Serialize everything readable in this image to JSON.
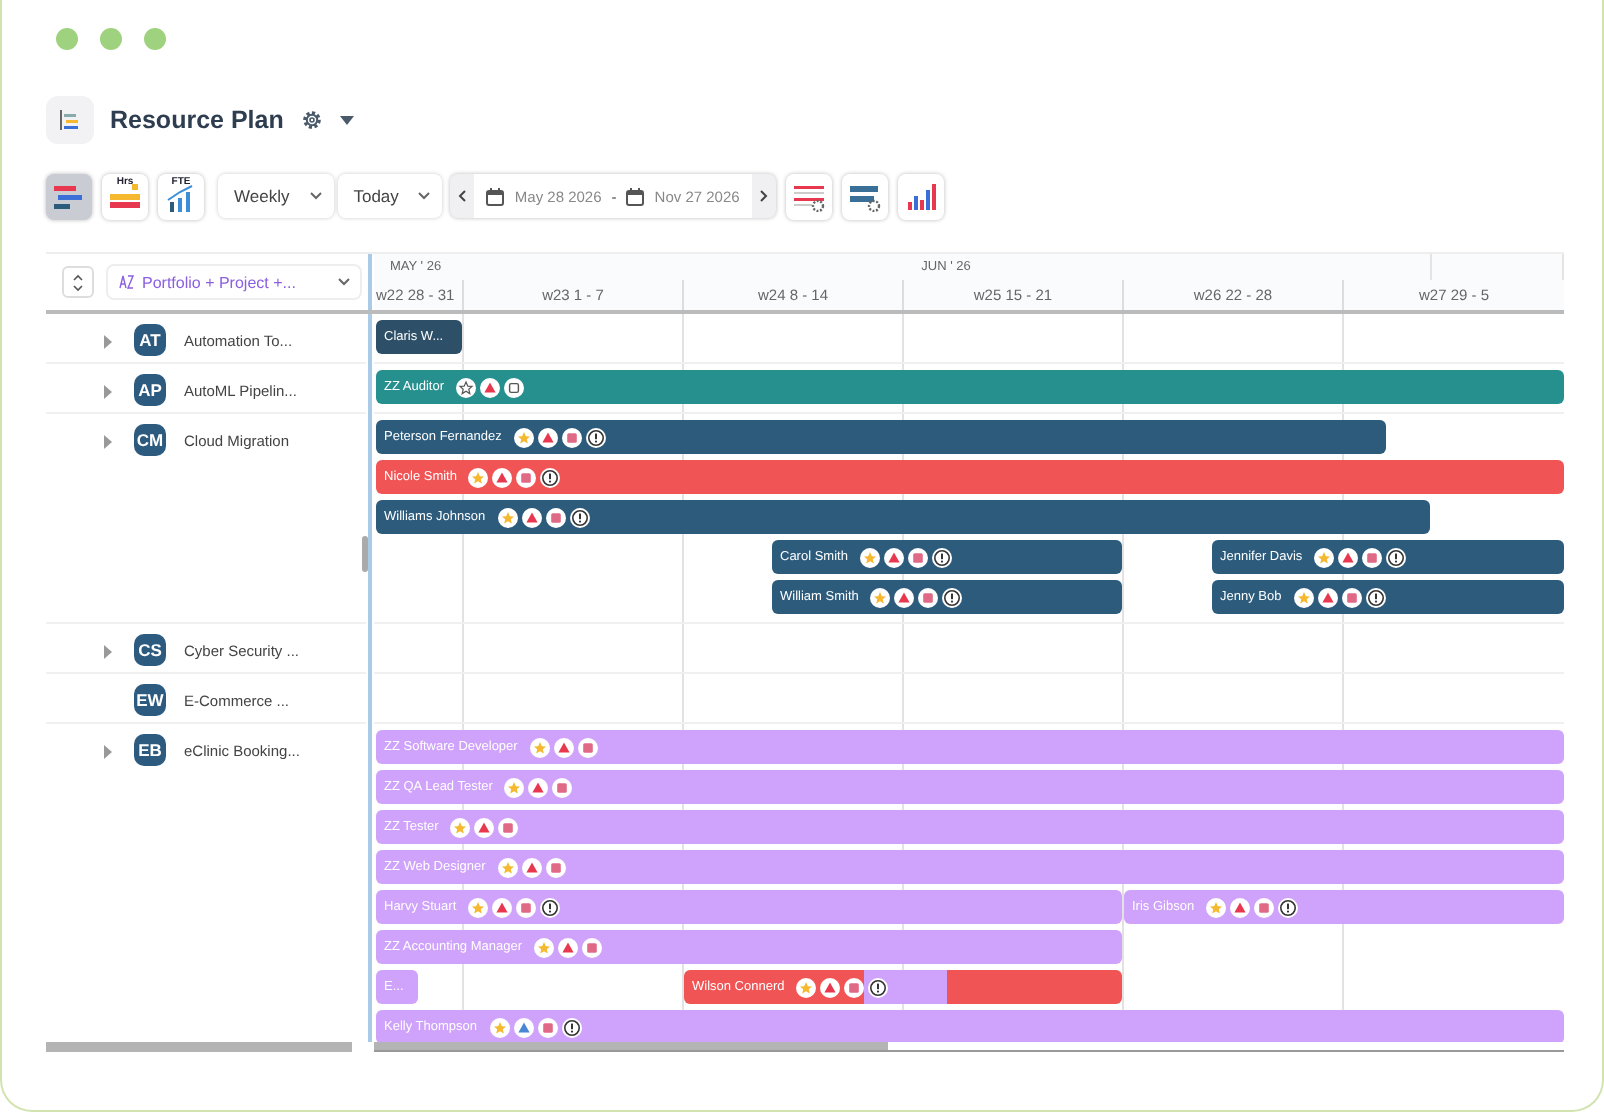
{
  "header": {
    "title": "Resource Plan"
  },
  "toolbar": {
    "views": [
      {
        "kind": "bars",
        "selected": true
      },
      {
        "kind": "hours",
        "label": "Hrs",
        "selected": false
      },
      {
        "kind": "fte",
        "label": "FTE",
        "selected": false
      }
    ],
    "period": "Weekly",
    "jump": "Today",
    "range": {
      "from": "May 28 2026",
      "separator": "-",
      "to": "Nov 27 2026"
    }
  },
  "grid": {
    "filter": "Portfolio + Project +...",
    "months": [
      "MAY ' 26",
      "JUN ' 26"
    ],
    "weeks": [
      "w22 28 - 31",
      "w23 1 - 7",
      "w24 8 - 14",
      "w25 15 - 21",
      "w26 22 - 28",
      "w27 29 - 5"
    ],
    "projects": [
      {
        "initials": "AT",
        "name": "Automation To...",
        "expandable": true,
        "lanes": [
          [
            {
              "name": "Claris W...",
              "color": "#2e4f68"
            }
          ]
        ]
      },
      {
        "initials": "AP",
        "name": "AutoML Pipelin...",
        "expandable": true,
        "lanes": [
          [
            {
              "name": "ZZ Auditor",
              "color": "#26908f",
              "icons": [
                {
                  "kind": "star-outline"
                },
                {
                  "kind": "triangle"
                },
                {
                  "kind": "square-outline"
                }
              ]
            }
          ]
        ]
      },
      {
        "initials": "CM",
        "name": "Cloud Migration",
        "expandable": true,
        "lanes": [
          [
            {
              "name": "Peterson Fernandez",
              "color": "#2c5b7c",
              "icons": [
                {
                  "kind": "star"
                },
                {
                  "kind": "triangle"
                },
                {
                  "kind": "square"
                },
                {
                  "kind": "alert"
                }
              ]
            }
          ],
          [
            {
              "name": "Nicole Smith",
              "color": "#f05454",
              "icons": [
                {
                  "kind": "star"
                },
                {
                  "kind": "triangle"
                },
                {
                  "kind": "square"
                },
                {
                  "kind": "alert"
                }
              ]
            }
          ],
          [
            {
              "name": "Williams Johnson",
              "color": "#2c5b7c",
              "icons": [
                {
                  "kind": "star"
                },
                {
                  "kind": "triangle"
                },
                {
                  "kind": "square"
                },
                {
                  "kind": "alert"
                }
              ]
            }
          ],
          [
            {
              "name": "Carol Smith",
              "color": "#2c5b7c",
              "icons": [
                {
                  "kind": "star"
                },
                {
                  "kind": "triangle"
                },
                {
                  "kind": "square"
                },
                {
                  "kind": "alert"
                }
              ]
            },
            {
              "name": "Jennifer Davis",
              "color": "#2c5b7c",
              "icons": [
                {
                  "kind": "star"
                },
                {
                  "kind": "triangle"
                },
                {
                  "kind": "square"
                },
                {
                  "kind": "alert"
                }
              ]
            }
          ],
          [
            {
              "name": "William Smith",
              "color": "#2c5b7c",
              "icons": [
                {
                  "kind": "star"
                },
                {
                  "kind": "triangle"
                },
                {
                  "kind": "square"
                },
                {
                  "kind": "alert"
                }
              ]
            },
            {
              "name": "Jenny Bob",
              "color": "#2c5b7c",
              "icons": [
                {
                  "kind": "star"
                },
                {
                  "kind": "triangle"
                },
                {
                  "kind": "square"
                },
                {
                  "kind": "alert"
                }
              ]
            }
          ]
        ]
      },
      {
        "initials": "CS",
        "name": "Cyber Security ...",
        "expandable": true
      },
      {
        "initials": "EW",
        "name": "E-Commerce ...",
        "expandable": false
      },
      {
        "initials": "EB",
        "name": "eClinic Booking...",
        "expandable": true,
        "lanes": [
          [
            {
              "name": "ZZ Software Developer",
              "color": "#cfa2fb",
              "icons": [
                {
                  "kind": "star"
                },
                {
                  "kind": "triangle"
                },
                {
                  "kind": "square"
                }
              ]
            }
          ],
          [
            {
              "name": "ZZ QA Lead Tester",
              "color": "#cfa2fb",
              "icons": [
                {
                  "kind": "star"
                },
                {
                  "kind": "triangle"
                },
                {
                  "kind": "square"
                }
              ]
            }
          ],
          [
            {
              "name": "ZZ Tester",
              "color": "#cfa2fb",
              "icons": [
                {
                  "kind": "star"
                },
                {
                  "kind": "triangle"
                },
                {
                  "kind": "square"
                }
              ]
            }
          ],
          [
            {
              "name": "ZZ Web Designer",
              "color": "#cfa2fb",
              "icons": [
                {
                  "kind": "star"
                },
                {
                  "kind": "triangle"
                },
                {
                  "kind": "square"
                }
              ]
            }
          ],
          [
            {
              "name": "Harvy Stuart",
              "color": "#cfa2fb",
              "icons": [
                {
                  "kind": "star"
                },
                {
                  "kind": "triangle"
                },
                {
                  "kind": "square"
                },
                {
                  "kind": "alert"
                }
              ]
            },
            {
              "name": "Iris Gibson",
              "color": "#cfa2fb",
              "icons": [
                {
                  "kind": "star"
                },
                {
                  "kind": "triangle"
                },
                {
                  "kind": "square"
                },
                {
                  "kind": "alert"
                }
              ]
            }
          ],
          [
            {
              "name": "ZZ Accounting Manager",
              "color": "#cfa2fb",
              "icons": [
                {
                  "kind": "star"
                },
                {
                  "kind": "triangle"
                },
                {
                  "kind": "square"
                }
              ]
            }
          ],
          [
            {
              "name": "E...",
              "color": "#cfa2fb"
            },
            {
              "name": "Wilson Connerd",
              "color": "#f05454",
              "kind": "split",
              "segments": [
                {
                  "color": "#f05454"
                },
                {
                  "color": "#cfa2fb"
                },
                {
                  "color": "#f05454"
                }
              ],
              "icons": [
                {
                  "kind": "star"
                },
                {
                  "kind": "triangle"
                },
                {
                  "kind": "square"
                },
                {
                  "kind": "alert"
                }
              ]
            }
          ],
          [
            {
              "name": "Kelly Thompson",
              "color": "#cfa2fb",
              "icons": [
                {
                  "kind": "star"
                },
                {
                  "kind": "triangle-alt"
                },
                {
                  "kind": "square"
                },
                {
                  "kind": "alert"
                }
              ]
            }
          ]
        ]
      }
    ]
  }
}
